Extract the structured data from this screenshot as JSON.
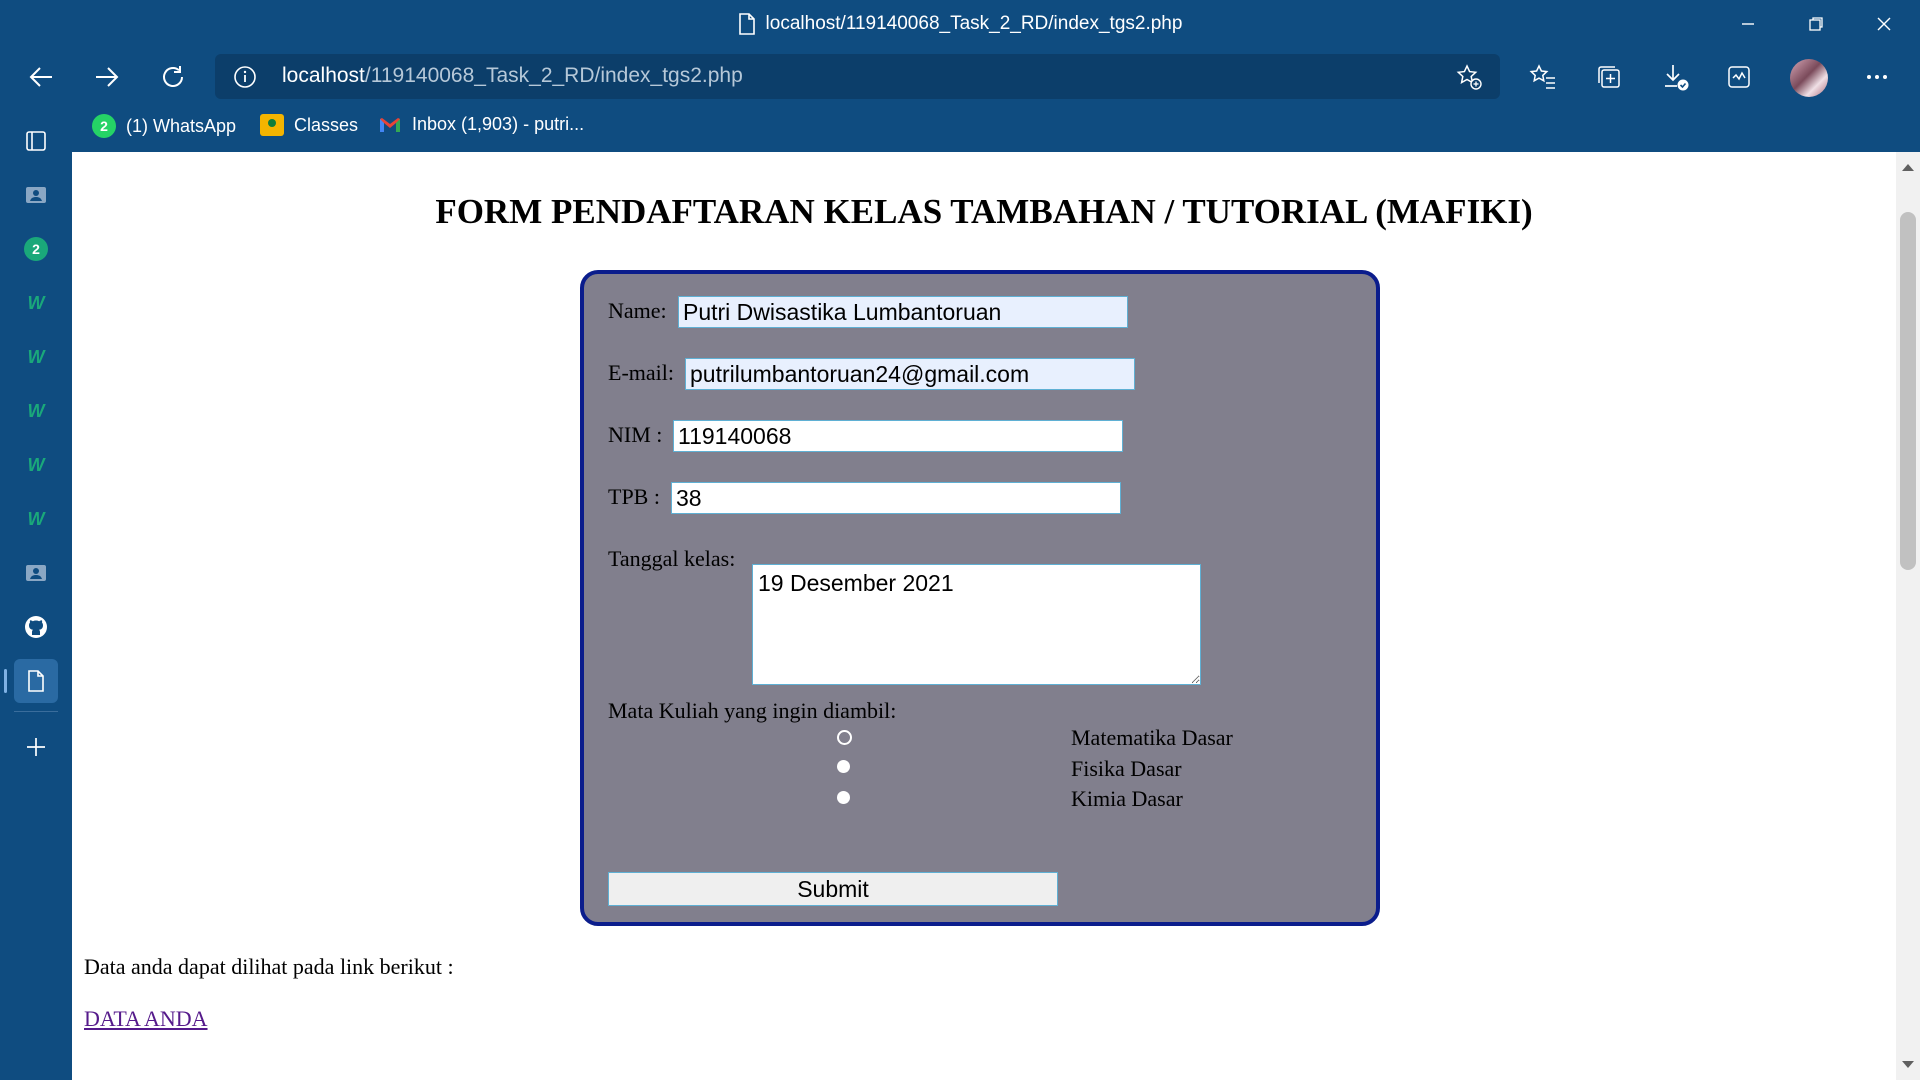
{
  "window": {
    "title": "localhost/119140068_Task_2_RD/index_tgs2.php"
  },
  "address_bar": {
    "host": "localhost",
    "path": "/119140068_Task_2_RD/index_tgs2.php"
  },
  "bookmarks": [
    {
      "label": "(1) WhatsApp",
      "icon": "whatsapp-icon",
      "badge": "2"
    },
    {
      "label": "Classes",
      "icon": "google-classroom-icon"
    },
    {
      "label": "Inbox (1,903) - putri...",
      "icon": "gmail-icon"
    }
  ],
  "sidebar": {
    "whatsapp_badge": "2",
    "w_items": [
      "W",
      "W",
      "W",
      "W",
      "W"
    ]
  },
  "page": {
    "title": "FORM PENDAFTARAN KELAS TAMBAHAN / TUTORIAL (MAFIKI)",
    "form": {
      "name_label": "Name:",
      "name_value": "Putri Dwisastika Lumbantoruan",
      "email_label": "E-mail:",
      "email_value": "putrilumbantoruan24@gmail.com",
      "nim_label": "NIM :",
      "nim_value": "119140068",
      "tpb_label": "TPB :",
      "tpb_value": "38",
      "tanggal_label": "Tanggal kelas:",
      "tanggal_value": "19 Desember 2021",
      "matkul_label": "Mata Kuliah yang ingin diambil:",
      "options": [
        "Matematika Dasar",
        "Fisika Dasar",
        "Kimia Dasar"
      ],
      "submit_label": "Submit"
    },
    "info_text": "Data anda dapat dilihat pada link berikut :",
    "link_text": "DATA ANDA"
  },
  "colors": {
    "browser_chrome": "#0f4c80",
    "form_background": "#817f8d",
    "form_border": "#0b1d8c",
    "link": "#551a8b"
  }
}
